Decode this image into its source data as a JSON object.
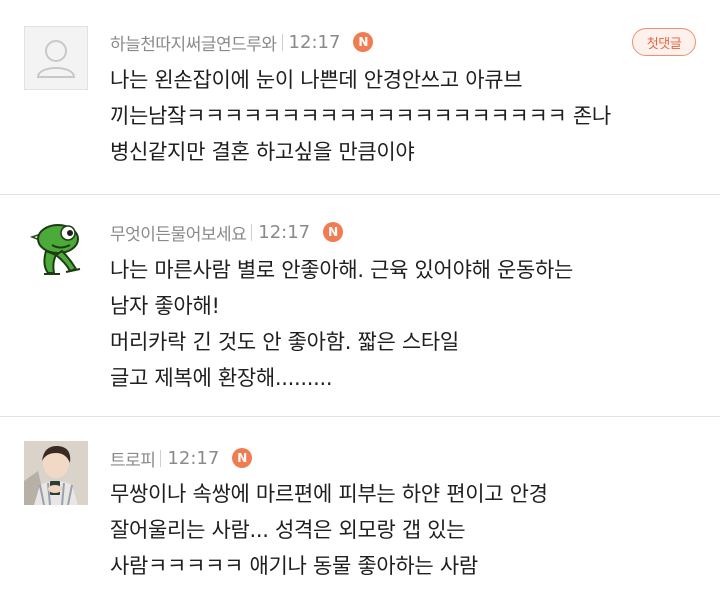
{
  "comments": [
    {
      "nickname": "하늘천따지써글연드루와",
      "time": "12:17",
      "n_badge": "N",
      "first_badge": "첫댓글",
      "lines": [
        "나는 왼손잡이에 눈이 나쁜데 안경안쓰고 아큐브",
        "끼는남잨ㅋㅋㅋㅋㅋㅋㅋㅋㅋㅋㅋㅋㅋㅋㅋㅋㅋㅋㅋㅋ 존나",
        "병신같지만 결혼 하고싶을 만큼이야"
      ],
      "avatar_icon": "default-profile-icon"
    },
    {
      "nickname": "무엇이든물어보세요",
      "time": "12:17",
      "n_badge": "N",
      "lines": [
        "나는 마른사람 별로 안좋아해. 근육 있어야해 운동하는",
        "남자 좋아해!",
        "머리카락 긴 것도 안 좋아함. 짧은 스타일",
        "글고 제복에 환장해........."
      ],
      "avatar_icon": "green-frog-icon"
    },
    {
      "nickname": "트로피",
      "time": "12:17",
      "n_badge": "N",
      "lines": [
        "무쌍이나 속쌍에 마르편에 피부는 하얀 편이고 안경",
        "잘어울리는 사람... 성격은 외모랑 갭 있는",
        "사람ㅋㅋㅋㅋㅋ 애기나 동물 좋아하는 사람"
      ],
      "avatar_icon": "profile-photo"
    }
  ],
  "colors": {
    "meta_text": "#8a8a8a",
    "n_badge_bg": "#f07d52",
    "first_badge_border": "#ef8f72",
    "first_badge_text": "#e8643f",
    "divider": "#e3e3e3"
  }
}
